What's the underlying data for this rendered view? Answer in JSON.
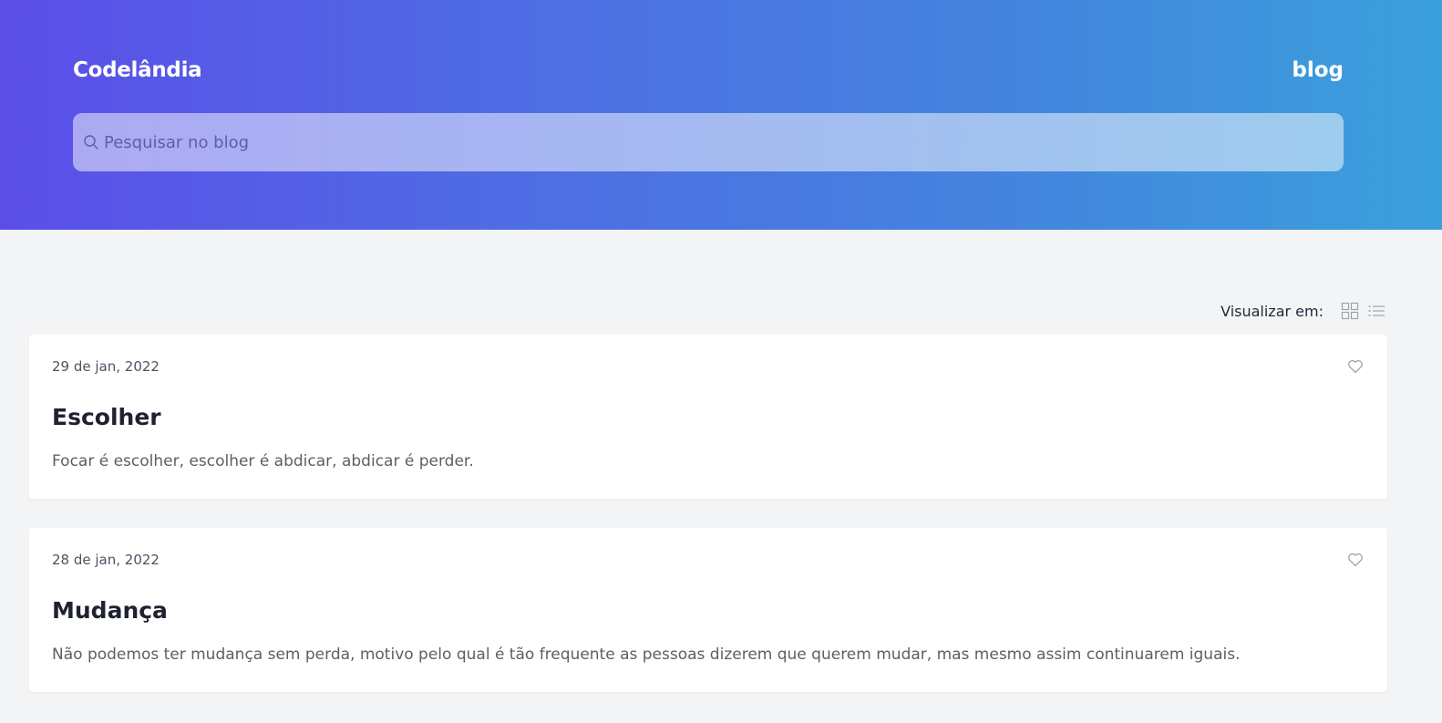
{
  "header": {
    "brand": "Codelândia",
    "section": "blog",
    "search": {
      "placeholder": "Pesquisar no blog",
      "value": ""
    }
  },
  "view": {
    "label": "Visualizar em:",
    "options": [
      {
        "icon": "grid-icon"
      },
      {
        "icon": "list-icon"
      }
    ]
  },
  "posts": [
    {
      "date": "29 de jan, 2022",
      "title": "Escolher",
      "excerpt": "Focar é escolher, escolher é abdicar, abdicar é perder.",
      "icon": "heart-icon"
    },
    {
      "date": "28 de jan, 2022",
      "title": "Mudança",
      "excerpt": "Não podemos ter mudança sem perda, motivo pelo qual é tão frequente as pessoas dizerem que querem mudar, mas mesmo assim continuarem iguais.",
      "icon": "heart-icon"
    }
  ],
  "colors": {
    "gradient_start": "#5b4ee8",
    "gradient_end": "#3aa0db",
    "page_bg": "#f3f4f6",
    "card_bg": "#ffffff",
    "title": "#1f2230"
  }
}
